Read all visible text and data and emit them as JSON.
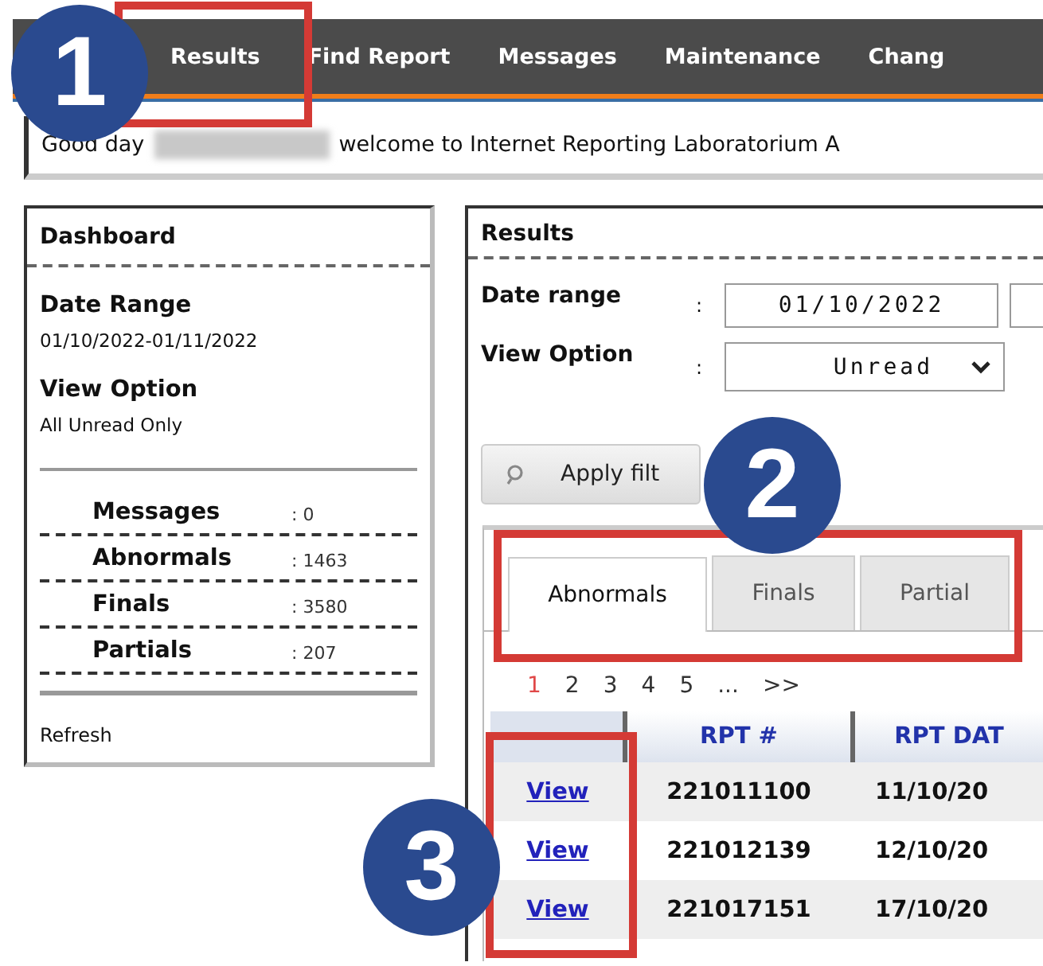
{
  "nav": {
    "items": [
      {
        "label": "Results"
      },
      {
        "label": "Find Report"
      },
      {
        "label": "Messages"
      },
      {
        "label": "Maintenance"
      },
      {
        "label": "Chang"
      }
    ]
  },
  "greeting": {
    "prefix": "Good day",
    "message": "welcome to Internet Reporting Laboratorium A"
  },
  "dashboard": {
    "title": "Dashboard",
    "date_range_label": "Date Range",
    "date_range": "01/10/2022-01/11/2022",
    "view_option_label": "View Option",
    "view_option": "All Unread Only",
    "stats": [
      {
        "label": "Messages",
        "value": ": 0"
      },
      {
        "label": "Abnormals",
        "value": ": 1463"
      },
      {
        "label": "Finals",
        "value": ": 3580"
      },
      {
        "label": "Partials",
        "value": ": 207"
      }
    ],
    "refresh": "Refresh"
  },
  "results": {
    "title": "Results",
    "fields": [
      {
        "kind": "daterange",
        "label": "Date range",
        "separator": ":",
        "value": "01/10/2022"
      },
      {
        "kind": "select",
        "label": "View Option",
        "separator": ":",
        "value": "Unread"
      }
    ],
    "apply_button": "Apply filt",
    "tabs": [
      {
        "label": "Abnormals",
        "selected": true
      },
      {
        "label": "Finals",
        "selected": false
      },
      {
        "label": "Partial",
        "selected": false
      }
    ],
    "pages": [
      {
        "label": "1",
        "selected": true
      },
      {
        "label": "2",
        "selected": false
      },
      {
        "label": "3",
        "selected": false
      },
      {
        "label": "4",
        "selected": false
      },
      {
        "label": "5",
        "selected": false
      },
      {
        "label": "...",
        "selected": false
      },
      {
        "label": ">>",
        "selected": false
      }
    ],
    "columns": [
      {
        "label": "RPT #"
      },
      {
        "label": "RPT DAT"
      }
    ],
    "rows": [
      {
        "link": "View",
        "rpt": "221011100",
        "date": "11/10/20"
      },
      {
        "link": "View",
        "rpt": "221012139",
        "date": "12/10/20"
      },
      {
        "link": "View",
        "rpt": "221017151",
        "date": "17/10/20"
      }
    ]
  },
  "callouts": [
    {
      "number": "1"
    },
    {
      "number": "2"
    },
    {
      "number": "3"
    }
  ]
}
